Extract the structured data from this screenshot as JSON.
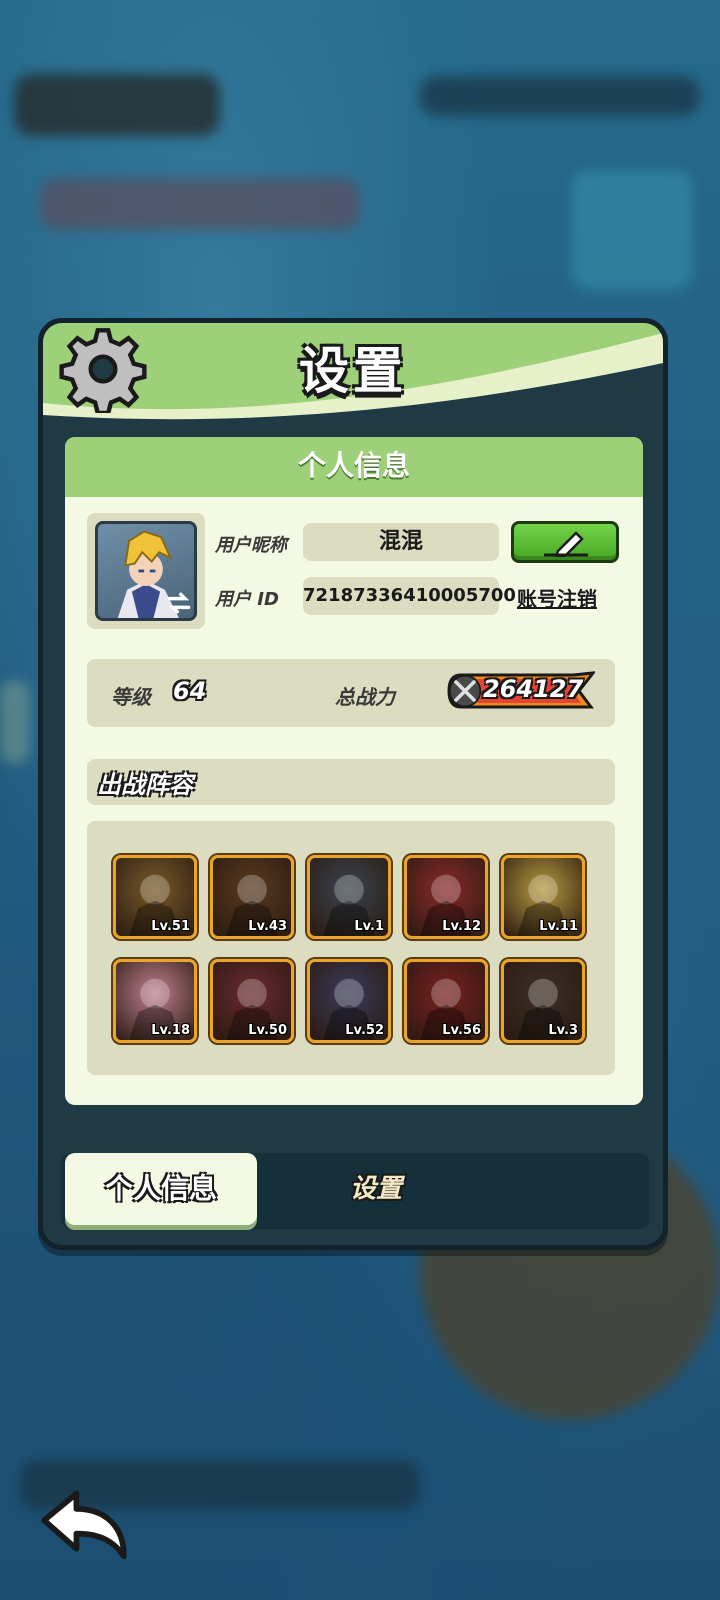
{
  "modal": {
    "title": "设置"
  },
  "profile": {
    "section_title": "个人信息",
    "nickname_label": "用户昵称",
    "nickname_value": "混混",
    "id_label": "用户 ID",
    "id_value": "72187336410005700",
    "cancel_account_label": "账号注销",
    "level_label": "等级",
    "level_value": "64",
    "power_label": "总战力",
    "power_value": "264127"
  },
  "lineup": {
    "title": "出战阵容",
    "heroes": [
      {
        "level": "Lv.51",
        "color": "#7a5a2a"
      },
      {
        "level": "Lv.43",
        "color": "#5a3a20"
      },
      {
        "level": "Lv.1",
        "color": "#3a4450"
      },
      {
        "level": "Lv.12",
        "color": "#8a2a2a"
      },
      {
        "level": "Lv.11",
        "color": "#b89a40"
      },
      {
        "level": "Lv.18",
        "color": "#c08090"
      },
      {
        "level": "Lv.50",
        "color": "#6a2a30"
      },
      {
        "level": "Lv.52",
        "color": "#3a3a5a"
      },
      {
        "level": "Lv.56",
        "color": "#7a2020"
      },
      {
        "level": "Lv.3",
        "color": "#3a3028"
      }
    ]
  },
  "tabs": {
    "active": "个人信息",
    "inactive": "设置"
  },
  "icons": {
    "header": "gear-icon",
    "edit": "pencil-icon",
    "power": "crossed-swords-icon",
    "back": "back-arrow-icon",
    "avatar_swap": "swap-arrows-icon"
  }
}
